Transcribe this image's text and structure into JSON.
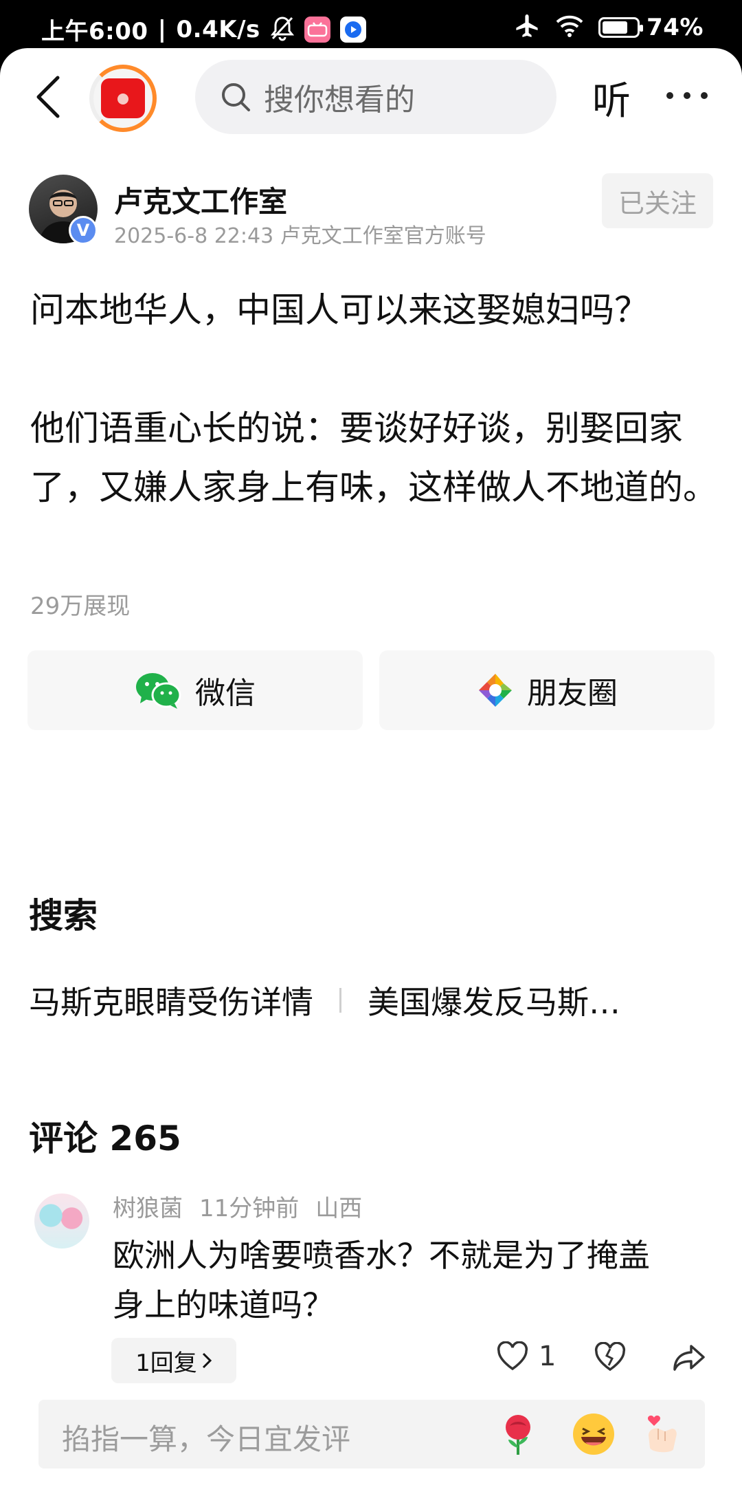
{
  "status_bar": {
    "time": "上午6:00",
    "network_speed": "0.4K/s",
    "battery_percent": "74%",
    "battery_level": 0.74,
    "icons": [
      "mute-bell-icon",
      "bilibili-app-icon",
      "video-app-icon",
      "airplane-icon",
      "wifi-icon",
      "battery-icon"
    ]
  },
  "header": {
    "search_placeholder": "搜你想看的",
    "listen_label": "听",
    "icons": [
      "back-arrow-icon",
      "app-logo",
      "search-icon",
      "more-dots-icon"
    ]
  },
  "author": {
    "name": "卢克文工作室",
    "meta": "2025-6-8 22:43 卢克文工作室官方账号",
    "verified_badge": "V",
    "follow_label": "已关注"
  },
  "post": {
    "line1": "问本地华人，中国人可以来这娶媳妇吗？",
    "line2": "他们语重心长的说：要谈好好谈，别娶回家了，又嫌人家身上有味，这样做人不地道的。",
    "views": "29万展现"
  },
  "share": {
    "wechat_label": "微信",
    "moments_label": "朋友圈",
    "wechat_color": "#20b14a"
  },
  "search_section": {
    "title": "搜索",
    "trends": [
      "马斯克眼睛受伤详情",
      "美国爆发反马斯…"
    ]
  },
  "comments": {
    "title": "评论 265",
    "items": [
      {
        "user": "树狼菌",
        "time": "11分钟前",
        "location": "山西",
        "text_line1": "欧洲人为啥要喷香水？不就是为了掩盖",
        "text_line2": "身上的味道吗？",
        "reply_label": "1回复",
        "like_count": "1"
      }
    ]
  },
  "input_bar": {
    "placeholder": "掐指一算，今日宜发评",
    "emojis": [
      "rose-emoji",
      "laughing-emoji",
      "finger-heart-emoji"
    ]
  }
}
